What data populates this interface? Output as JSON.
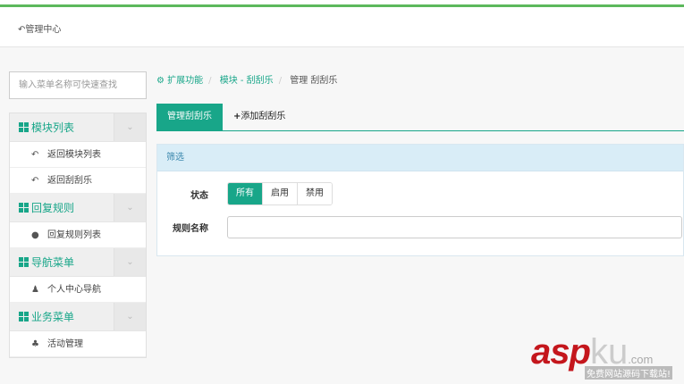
{
  "header": {
    "back_icon": "reply-icon",
    "title": "管理中心"
  },
  "sidebar": {
    "search_placeholder": "输入菜单名称可快速查找",
    "groups": [
      {
        "title": "模块列表",
        "items": [
          {
            "icon": "reply-icon",
            "label": "返回模块列表"
          },
          {
            "icon": "reply-icon",
            "label": "返回刮刮乐"
          }
        ]
      },
      {
        "title": "回复规则",
        "items": [
          {
            "icon": "comments-icon",
            "label": "回复规则列表"
          }
        ]
      },
      {
        "title": "导航菜单",
        "items": [
          {
            "icon": "user-icon",
            "label": "个人中心导航"
          }
        ]
      },
      {
        "title": "业务菜单",
        "items": [
          {
            "icon": "activity-icon",
            "label": "活动管理"
          }
        ]
      }
    ]
  },
  "breadcrumb": {
    "items": [
      "扩展功能",
      "模块 - 刮刮乐"
    ],
    "current": "管理 刮刮乐"
  },
  "tabs": {
    "manage": "管理刮刮乐",
    "add": "添加刮刮乐"
  },
  "filter": {
    "title": "筛选",
    "status_label": "状态",
    "status_options": [
      "所有",
      "启用",
      "禁用"
    ],
    "name_label": "规则名称",
    "name_value": ""
  },
  "watermark": {
    "brand_a": "asp",
    "brand_b": "ku",
    ".com": ".com",
    "slogan": "免费网站源码下载站!"
  },
  "colors": {
    "accent": "#18a689",
    "top_line": "#5cb85c"
  }
}
